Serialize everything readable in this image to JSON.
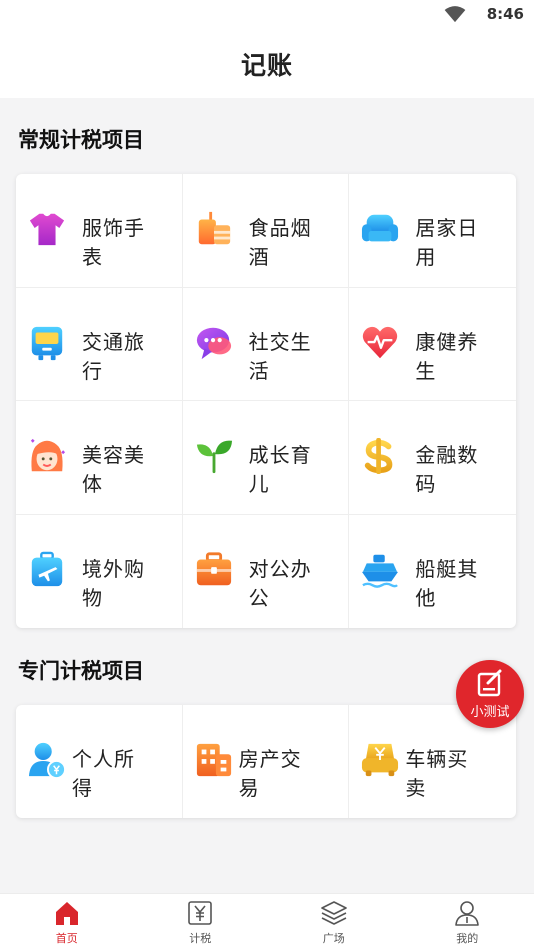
{
  "status_bar": {
    "time": "8:46",
    "wifi_icon": "wifi-icon"
  },
  "header": {
    "title": "记账"
  },
  "regular_section": {
    "title": "常规计税项目",
    "items": [
      {
        "label": "服饰手表",
        "icon": "tshirt-icon"
      },
      {
        "label": "食品烟酒",
        "icon": "food-drink-icon"
      },
      {
        "label": "居家日用",
        "icon": "sofa-icon"
      },
      {
        "label": "交通旅行",
        "icon": "bus-icon"
      },
      {
        "label": "社交生活",
        "icon": "chat-bubble-icon"
      },
      {
        "label": "康健养生",
        "icon": "heart-pulse-icon"
      },
      {
        "label": "美容美体",
        "icon": "woman-face-icon"
      },
      {
        "label": "成长育儿",
        "icon": "sprout-icon"
      },
      {
        "label": "金融数码",
        "icon": "dollar-icon"
      },
      {
        "label": "境外购物",
        "icon": "luggage-plane-icon"
      },
      {
        "label": "对公办公",
        "icon": "briefcase-icon"
      },
      {
        "label": "船艇其他",
        "icon": "ship-icon"
      }
    ]
  },
  "special_section": {
    "title": "专门计税项目",
    "items": [
      {
        "label": "个人所得",
        "icon": "person-yuan-icon"
      },
      {
        "label": "房产交易",
        "icon": "building-icon"
      },
      {
        "label": "车辆买卖",
        "icon": "car-yuan-icon"
      }
    ]
  },
  "fab": {
    "label": "小测试",
    "icon": "edit-note-icon"
  },
  "tabbar": {
    "items": [
      {
        "label": "首页",
        "icon": "home-icon",
        "active": true
      },
      {
        "label": "计税",
        "icon": "yuan-box-icon",
        "active": false
      },
      {
        "label": "广场",
        "icon": "layers-icon",
        "active": false
      },
      {
        "label": "我的",
        "icon": "user-icon",
        "active": false
      }
    ]
  },
  "colors": {
    "accent": "#d9262c",
    "background": "#f4f4f5",
    "card": "#ffffff"
  }
}
